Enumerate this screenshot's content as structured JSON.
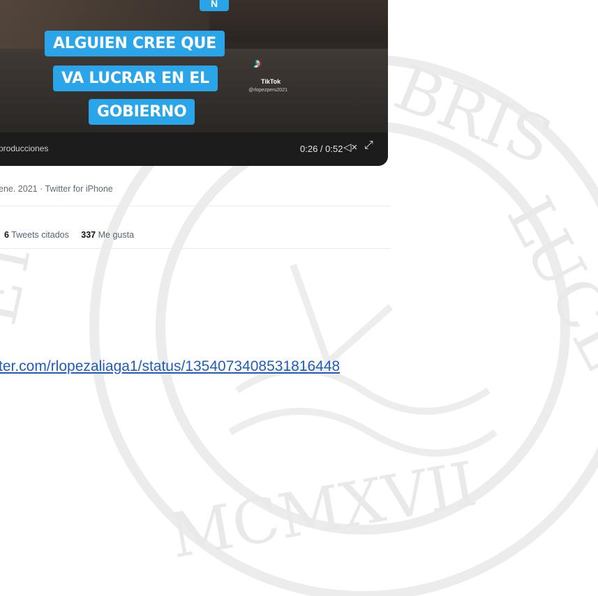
{
  "video": {
    "top_badge": "N",
    "caption_lines": [
      "ALGUIEN CREE QUE",
      "VA LUCRAR EN EL",
      "GOBIERNO"
    ],
    "tiktok_brand": "TikTok",
    "tiktok_handle": "@rlopezperu2021",
    "channel": "producciones",
    "time": "0:26 / 0:52",
    "mute_icon": "speaker-muted-icon",
    "expand_icon": "expand-icon"
  },
  "tweet": {
    "meta": "ene. 2021 · Twitter for iPhone",
    "quote_count": "6",
    "quote_label": "Tweets citados",
    "like_count": "337",
    "like_label": "Me gusta"
  },
  "link": {
    "text": "ter.com/rlopezaliaga1/status/1354073408531816448"
  },
  "watermark": {
    "roman": "MCMXVII",
    "motto_left": "ET",
    "motto_top": "BRIS",
    "motto_right": "LUCET"
  }
}
